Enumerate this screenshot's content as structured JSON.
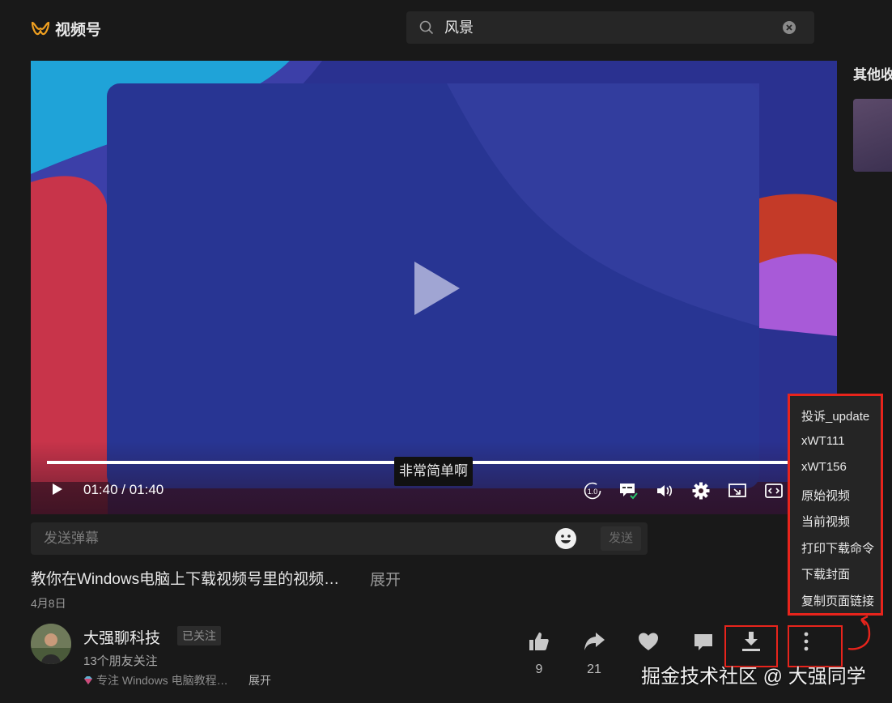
{
  "header": {
    "app_name": "视频号",
    "brand_color": "#f0a020",
    "search": {
      "value": "风景",
      "icon": "search-icon",
      "clear_icon": "clear-icon"
    }
  },
  "player": {
    "subtitle": "非常简单啊",
    "time": "01:40 / 01:40",
    "progress": 1.0,
    "speed_label": "1.0",
    "controls": [
      "play-icon",
      "speed-icon",
      "danmaku-toggle-icon",
      "volume-icon",
      "settings-icon",
      "pip-icon",
      "fullscreen-icon"
    ]
  },
  "danmaku": {
    "placeholder": "发送弹幕",
    "send_label": "发送"
  },
  "video": {
    "title": "教你在Windows电脑上下载视频号里的视频…",
    "expand_label": "展开",
    "date": "4月8日"
  },
  "author": {
    "name": "大强聊科技",
    "follow_status": "已关注",
    "friends": "13个朋友关注",
    "bio": "专注 Windows 电脑教程…",
    "bio_expand": "展开"
  },
  "actions": {
    "like_count": "9",
    "share_count": "21"
  },
  "menu": {
    "items": [
      "投诉_update",
      "xWT111",
      "xWT156",
      "原始视频",
      "当前视频",
      "打印下载命令",
      "下载封面",
      "复制页面链接"
    ]
  },
  "sidebar": {
    "title": "其他收"
  },
  "watermark": "掘金技术社区 @ 大强同学",
  "colors": {
    "highlight": "#e8241c",
    "background": "#191919"
  }
}
